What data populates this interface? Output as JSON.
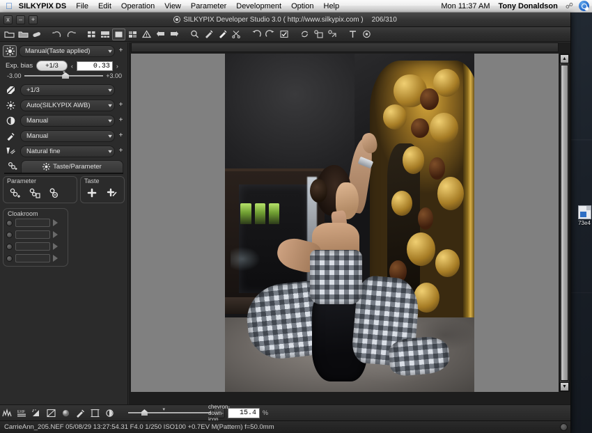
{
  "menubar": {
    "apple_icon": "apple-icon",
    "app_name": "SILKYPIX DS",
    "items": [
      "File",
      "Edit",
      "Operation",
      "View",
      "Parameter",
      "Development",
      "Option",
      "Help"
    ],
    "clock": "Mon 11:37 AM",
    "user": "Tony Donaldson",
    "bluetooth_icon": "bluetooth-icon",
    "spotlight_icon": "search-icon"
  },
  "window": {
    "close_label": "x",
    "minimize_label": "–",
    "maximize_label": "+",
    "title": "SILKYPIX Developer Studio 3.0 ( http://www.silkypix.com )",
    "counter": "206/310",
    "title_icon": "silkypix-logo-icon"
  },
  "toolbar": {
    "items": [
      {
        "name": "open-folder-icon"
      },
      {
        "name": "open-folder-alt-icon"
      },
      {
        "name": "batch-icon"
      },
      {
        "name": "undo-icon"
      },
      {
        "name": "redo-icon"
      },
      {
        "name": "thumbnail-grid-icon"
      },
      {
        "name": "filmstrip-icon"
      },
      {
        "name": "single-view-icon"
      },
      {
        "name": "compare-view-icon"
      },
      {
        "name": "warning-icon"
      },
      {
        "name": "previous-image-icon"
      },
      {
        "name": "next-image-icon"
      },
      {
        "name": "zoom-icon"
      },
      {
        "name": "white-balance-picker-icon"
      },
      {
        "name": "gray-balance-picker-icon"
      },
      {
        "name": "scissors-icon"
      },
      {
        "name": "rotate-left-icon"
      },
      {
        "name": "rotate-right-icon"
      },
      {
        "name": "check-mark-icon"
      },
      {
        "name": "rotate-refresh-icon"
      },
      {
        "name": "save-develop-icon"
      },
      {
        "name": "develop-batch-icon"
      },
      {
        "name": "text-tool-icon"
      },
      {
        "name": "silkypix-mark-icon"
      }
    ]
  },
  "sidebar": {
    "exposure": {
      "icon": "exposure-sun-icon",
      "mode": "Manual(Taste applied)",
      "plus": "+",
      "bias_label": "Exp. bias",
      "bias_step": "+1/3",
      "dec": "‹",
      "inc": "›",
      "value": "0.33",
      "slider_min": "-3.00",
      "slider_max": "+3.00"
    },
    "controls": [
      {
        "icon": "exposure-compensation-icon",
        "value": "+1/3",
        "has_plus": false
      },
      {
        "icon": "white-balance-icon",
        "value": "Auto(SILKYPIX AWB)",
        "has_plus": true
      },
      {
        "icon": "contrast-icon",
        "value": "Manual",
        "has_plus": true
      },
      {
        "icon": "color-tone-icon",
        "value": "Manual",
        "has_plus": true
      },
      {
        "icon": "sharpness-icon",
        "value": "Natural fine",
        "has_plus": true
      }
    ],
    "tab": {
      "side_icon": "parameter-add-icon",
      "icon": "taste-gear-icon",
      "label": "Taste/Parameter"
    },
    "parameter_group": {
      "label": "Parameter",
      "buttons": [
        "parameter-add-icon",
        "parameter-copy-icon",
        "parameter-apply-icon"
      ]
    },
    "taste_group": {
      "label": "Taste",
      "buttons": [
        "taste-add-icon",
        "taste-apply-icon"
      ]
    },
    "cloakroom": {
      "label": "Cloakroom",
      "slots": [
        {
          "dot": "cloakroom-radio",
          "value": "",
          "arrow": "▶"
        },
        {
          "dot": "cloakroom-radio",
          "value": "",
          "arrow": "▶"
        },
        {
          "dot": "cloakroom-radio",
          "value": "",
          "arrow": "▶"
        },
        {
          "dot": "cloakroom-radio",
          "value": "",
          "arrow": "▶"
        }
      ]
    }
  },
  "viewer": {
    "photo_alt": "woman-in-gingham-gown-reaching-toward-gilded-baroque-mirror",
    "vscroll_up": "▲",
    "vscroll_down": "▼",
    "hscroll_left": "◀",
    "hscroll_right": "▶"
  },
  "bottombar": {
    "tools": [
      {
        "name": "histogram-icon"
      },
      {
        "name": "exif-icon"
      },
      {
        "name": "highlight-warning-icon"
      },
      {
        "name": "tone-curve-icon"
      },
      {
        "name": "sphere-preview-icon"
      },
      {
        "name": "color-gradient-icon"
      },
      {
        "name": "crop-aspect-icon"
      },
      {
        "name": "rotate-preview-icon"
      }
    ],
    "zoom": {
      "combo_icon": "chevron-down-icon",
      "value": "15.4",
      "percent": "%"
    }
  },
  "statusbar": {
    "text": "CarrieAnn_205.NEF 05/08/29 13:27:54.31 F4.0 1/250 ISO100 +0.7EV M(Pattern) f=50.0mm",
    "resize_grip": "resize-grip-icon"
  },
  "desktop": {
    "icon_label": "73e4"
  },
  "colors": {
    "accent": "#2b6fc9",
    "panel": "#2b2b2b",
    "canvas": "#808080",
    "menubar": "#ededed"
  }
}
